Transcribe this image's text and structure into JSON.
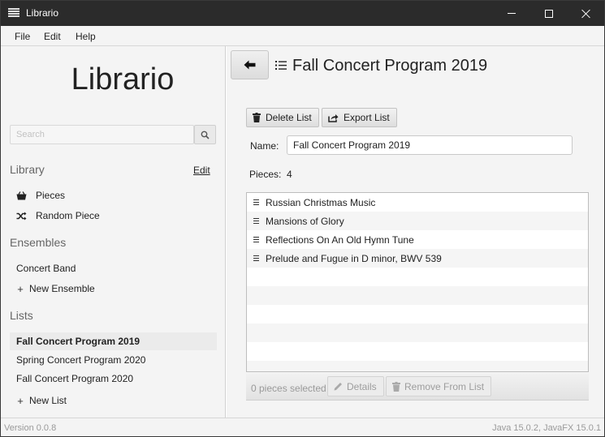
{
  "window": {
    "title": "Librario"
  },
  "menu": {
    "file": "File",
    "edit": "Edit",
    "help": "Help"
  },
  "sidebar": {
    "app_title": "Librario",
    "search_placeholder": "Search",
    "library": {
      "heading": "Library",
      "edit_label": "Edit",
      "items": [
        {
          "label": "Pieces",
          "icon": "basket-icon"
        },
        {
          "label": "Random Piece",
          "icon": "shuffle-icon"
        }
      ]
    },
    "ensembles": {
      "heading": "Ensembles",
      "items": [
        "Concert Band"
      ],
      "new_label": "New Ensemble"
    },
    "lists": {
      "heading": "Lists",
      "items": [
        "Fall Concert Program 2019",
        "Spring Concert Program 2020",
        "Fall Concert Program 2020"
      ],
      "selected": "Fall Concert Program 2019",
      "new_label": "New List"
    }
  },
  "main": {
    "title": "Fall Concert Program 2019",
    "toolbar": {
      "delete_label": "Delete List",
      "export_label": "Export List"
    },
    "name_label": "Name:",
    "name_value": "Fall Concert Program 2019",
    "pieces_label": "Pieces:",
    "pieces_count": "4",
    "pieces": [
      "Russian Christmas Music",
      "Mansions of Glory",
      "Reflections On An Old Hymn Tune",
      "Prelude and Fugue in D minor, BWV 539"
    ],
    "selection_status": "0 pieces selected",
    "details_label": "Details",
    "remove_label": "Remove From List"
  },
  "status": {
    "version": "Version 0.0.8",
    "runtime": "Java 15.0.2, JavaFX 15.0.1"
  }
}
